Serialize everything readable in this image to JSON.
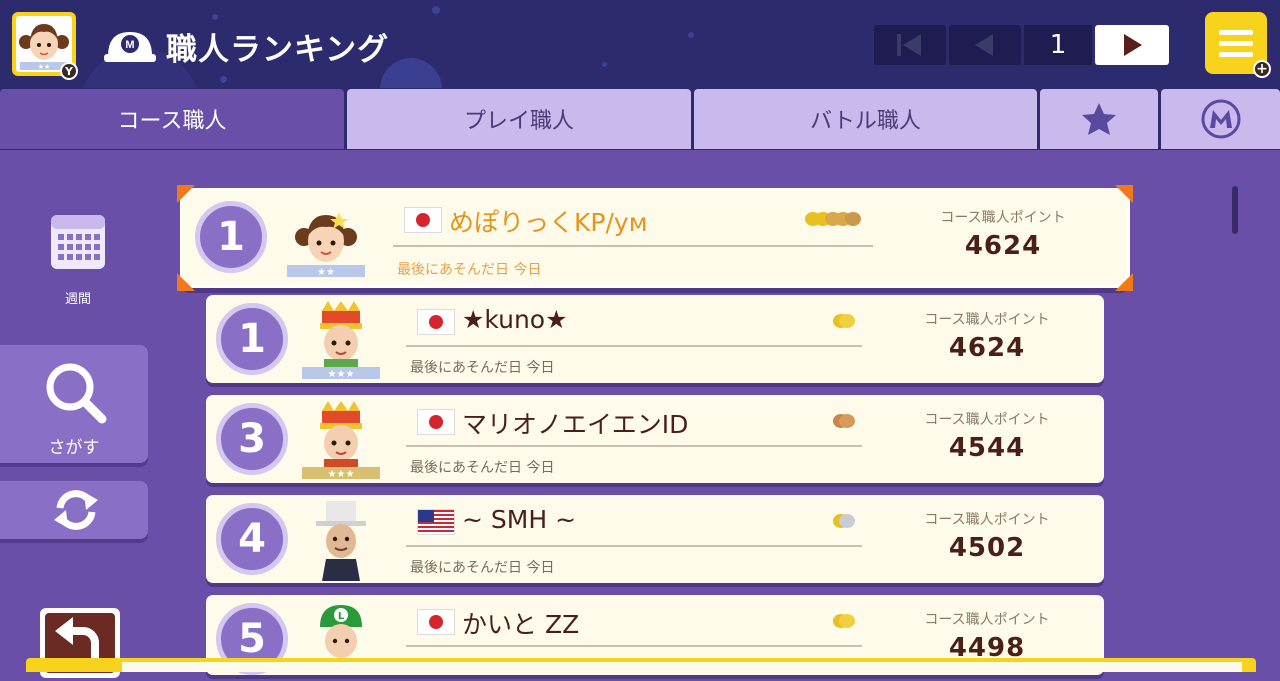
{
  "header": {
    "title": "職人ランキング",
    "avatar_badge": "Y",
    "menu_badge": "+",
    "page_number": "1"
  },
  "tabs": [
    {
      "label": "コース職人",
      "active": true
    },
    {
      "label": "プレイ職人",
      "active": false
    },
    {
      "label": "バトル職人",
      "active": false
    },
    {
      "icon": "star-icon"
    },
    {
      "icon": "mario-m-icon"
    }
  ],
  "side": {
    "period_label": "週間",
    "search_label": "さがす"
  },
  "colors": {
    "header_bg": "#2d2a6e",
    "panel_bg": "#6a4fa8",
    "tab_inactive": "#c9b9ec",
    "accent_yellow": "#f7d31c",
    "accent_orange": "#f07a1a",
    "name_dark": "#4a1f1a",
    "name_highlight": "#e8931b"
  },
  "rankings": {
    "points_label": "コース職人ポイント",
    "played_label": "最後にあそんだ日",
    "me": {
      "rank": "1",
      "flag": "jp",
      "name": "めぽりっくKP/yм",
      "played_value": "今日",
      "points": "4624",
      "medals": "gold-coins-5"
    },
    "rows": [
      {
        "rank": "1",
        "flag": "jp",
        "name": "★kuno★",
        "played_value": "今日",
        "points": "4624",
        "medal": "gold-coin-stack"
      },
      {
        "rank": "3",
        "flag": "jp",
        "name": "マリオノエイエンID",
        "played_value": "今日",
        "points": "4544",
        "medal": "bronze-coin-stack"
      },
      {
        "rank": "4",
        "flag": "us",
        "name": "~ SMH ~",
        "played_value": "今日",
        "points": "4502",
        "medal": "silver-coin-stack"
      },
      {
        "rank": "5",
        "flag": "jp",
        "name": "かいと ZZ",
        "played_value": "",
        "points": "4498",
        "medal": "gold-coin-stack"
      }
    ]
  }
}
